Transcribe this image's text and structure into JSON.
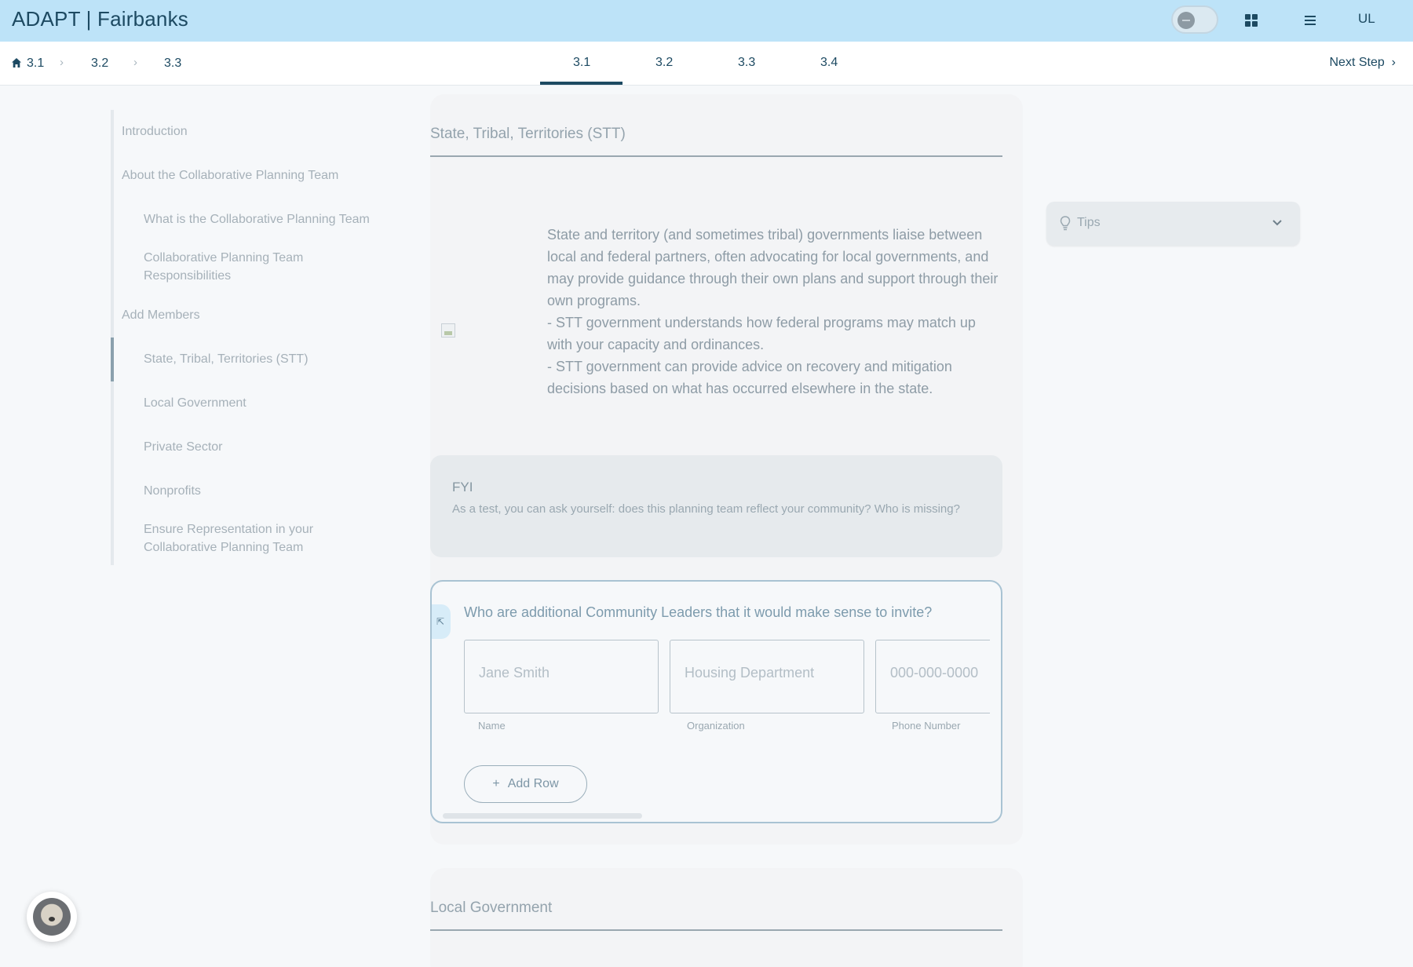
{
  "header": {
    "brand": "ADAPT | Fairbanks",
    "user_initials": "UL",
    "icons": [
      "theme-toggle",
      "grid-icon",
      "menu-icon"
    ]
  },
  "breadcrumb": {
    "items": [
      "3.1",
      "3.2",
      "3.3"
    ]
  },
  "tabs": {
    "items": [
      "3.1",
      "3.2",
      "3.3",
      "3.4"
    ],
    "active": "3.1",
    "next_label": "Next Step"
  },
  "sidebar": {
    "items": [
      "Introduction",
      "About the Collaborative Planning Team",
      "What is the Collaborative Planning Team",
      "Collaborative Planning Team",
      "Responsibilities",
      "Add Members",
      "State, Tribal, Territories (STT)",
      "Local Government",
      "Private Sector",
      "Nonprofits",
      "Ensure Representation in your",
      "Collaborative Planning Team"
    ],
    "active": "State, Tribal, Territories (STT)"
  },
  "main": {
    "section_title": "State, Tribal, Territories (STT)",
    "body_lines": [
      "State and territory (and sometimes tribal) governments liaise between local and federal partners, often advocating for local governments, and may provide guidance through their own plans and support through their own programs.",
      "- STT government understands how federal programs may match up with your capacity and ordinances.",
      "- STT government can provide advice on recovery and mitigation decisions based on what has occurred elsewhere in the state."
    ],
    "fyi": {
      "title": "FYI",
      "text": "As a test, you can ask yourself: does this planning team reflect your community? Who is missing?"
    },
    "question": {
      "title": "Who are additional Community Leaders that it would make sense to invite?",
      "fields": [
        {
          "placeholder": "Jane Smith",
          "label": "Name"
        },
        {
          "placeholder": "Housing Department",
          "label": "Organization"
        },
        {
          "placeholder": "000-000-0000",
          "label": "Phone Number"
        }
      ],
      "add_row_label": "Add Row"
    },
    "next_section_title": "Local Government"
  },
  "tips": {
    "label": "Tips"
  }
}
